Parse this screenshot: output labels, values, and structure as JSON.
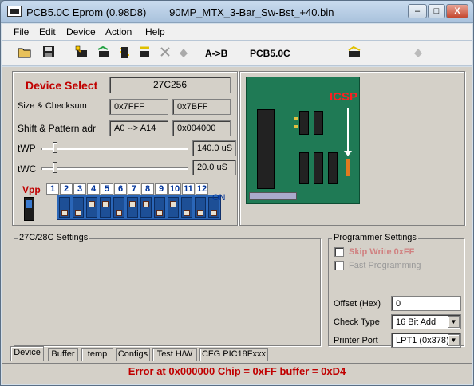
{
  "titlebar": {
    "title": "PCB5.0C Eprom (0.98D8)        90MP_MTX_3-Bar_Sw-Bst_+40.bin",
    "minimize": "–",
    "maximize": "□",
    "close": "X"
  },
  "menu": [
    {
      "label": "File"
    },
    {
      "label": "Edit"
    },
    {
      "label": "Device"
    },
    {
      "label": "Action"
    },
    {
      "label": "Help"
    }
  ],
  "toolbar": {
    "icons": [
      "open-folder-icon",
      "save-disk-icon",
      "read-chip-icon",
      "program-chip-icon",
      "verify-icon",
      "erase-icon",
      "blank-check-icon",
      "auto-icon",
      "disabled-icon-1",
      "disabled-icon-2"
    ],
    "ab_label": "A->B",
    "board_label": "PCB5.0C"
  },
  "device": {
    "title": "Device Select",
    "device_name": "27C256",
    "size_checksum_label": "Size & Checksum",
    "size_value": "0x7FFF",
    "checksum_value": "0x7BFF",
    "shift_label": "Shift & Pattern adr",
    "shift_value": "A0 --> A14",
    "pattern_value": "0x004000",
    "twp_label": "tWP",
    "twp_value": "140.0 uS",
    "twc_label": "tWC",
    "twc_value": "20.0 uS",
    "vpp_label": "Vpp",
    "dip_numbers": [
      "1",
      "2",
      "3",
      "4",
      "5",
      "6",
      "7",
      "8",
      "9",
      "10",
      "11",
      "12"
    ],
    "on_label": "ON",
    "dip_states": [
      false,
      false,
      true,
      true,
      false,
      true,
      true,
      false,
      true,
      false,
      false,
      false
    ]
  },
  "board": {
    "icsp_label": "ICSP"
  },
  "settings_group": {
    "title": "27C/28C Settings"
  },
  "programmer": {
    "title": "Programmer Settings",
    "skip_write_label": "Skip Write 0xFF",
    "fast_prog_label": "Fast Programming",
    "offset_label": "Offset (Hex)",
    "offset_value": "0",
    "check_type_label": "Check Type",
    "check_type_value": "16 Bit Add",
    "printer_port_label": "Printer Port",
    "printer_port_value": "LPT1 (0x378)"
  },
  "tabs": [
    {
      "label": "Device"
    },
    {
      "label": "Buffer"
    },
    {
      "label": "temp"
    },
    {
      "label": "Configs"
    },
    {
      "label": "Test H/W"
    },
    {
      "label": "CFG PIC18Fxxx"
    }
  ],
  "status": "Error at 0x000000  Chip = 0xFF  buffer = 0xD4",
  "colors": {
    "error_red": "#c00000",
    "dip_blue": "#2a66b8",
    "pcb_green": "#1f7a55"
  }
}
